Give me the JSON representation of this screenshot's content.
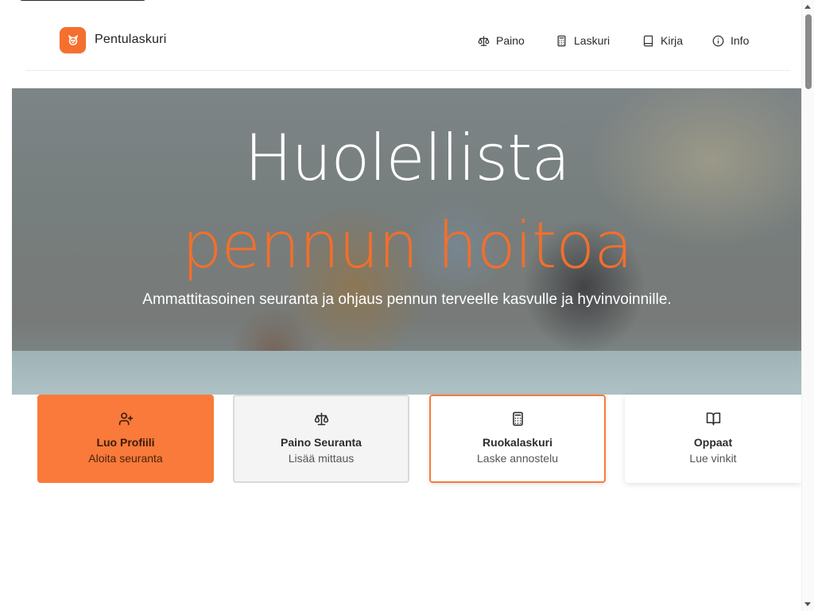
{
  "header": {
    "brand": "Pentulaskuri",
    "logo_icon": "paw-icon",
    "nav": [
      {
        "label": "Paino",
        "icon": "scale-icon"
      },
      {
        "label": "Laskuri",
        "icon": "calculator-icon"
      },
      {
        "label": "Kirja",
        "icon": "book-icon"
      },
      {
        "label": "Info",
        "icon": "info-icon"
      }
    ]
  },
  "hero": {
    "title": "Huolellista",
    "accent": "pennun hoitoa",
    "subtitle": "Ammattitasoinen seuranta ja ohjaus pennun terveelle kasvulle ja hyvinvoinnille."
  },
  "cards": [
    {
      "title": "Luo Profiili",
      "subtitle": "Aloita seuranta",
      "icon": "user-plus-icon"
    },
    {
      "title": "Paino Seuranta",
      "subtitle": "Lisää mittaus",
      "icon": "scale-icon"
    },
    {
      "title": "Ruokalaskuri",
      "subtitle": "Laske annostelu",
      "icon": "calculator-icon"
    },
    {
      "title": "Oppaat",
      "subtitle": "Lue vinkit",
      "icon": "book-open-icon"
    }
  ],
  "colors": {
    "accent": "#f97a3a",
    "accent_text": "#f26f2c"
  }
}
